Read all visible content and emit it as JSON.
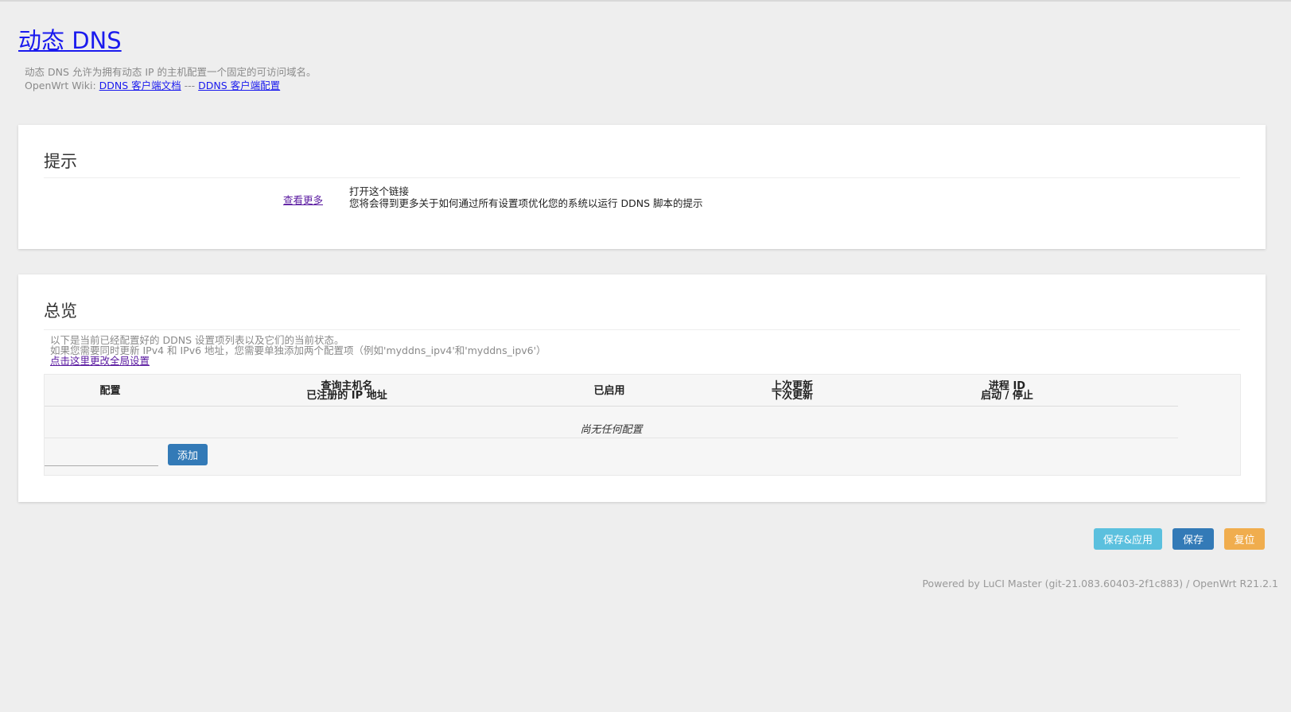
{
  "page": {
    "title": "动态 DNS",
    "intro_line1": "动态 DNS 允许为拥有动态 IP 的主机配置一个固定的可访问域名。",
    "wiki_prefix": "OpenWrt Wiki: ",
    "wiki_link1": "DDNS 客户端文档",
    "wiki_separator": " --- ",
    "wiki_link2": "DDNS 客户端配置"
  },
  "hints": {
    "title": "提示",
    "link_label": "查看更多",
    "line1": "打开这个链接",
    "line2": "您将会得到更多关于如何通过所有设置项优化您的系统以运行 DDNS 脚本的提示"
  },
  "overview": {
    "title": "总览",
    "desc_line1": "以下是当前已经配置好的 DDNS 设置项列表以及它们的当前状态。",
    "desc_line2": "如果您需要同时更新 IPv4 和 IPv6 地址，您需要单独添加两个配置项（例如'myddns_ipv4'和'myddns_ipv6'）",
    "global_link": "点击这里更改全局设置",
    "columns": {
      "config": "配置",
      "hostname_a": "查询主机名",
      "hostname_b": "已注册的 IP 地址",
      "enabled": "已启用",
      "update_a": "上次更新",
      "update_b": "下次更新",
      "pid_a": "进程 ID",
      "pid_b": "启动 / 停止"
    },
    "empty_text": "尚无任何配置",
    "add_input_value": "",
    "add_button": "添加"
  },
  "actions": {
    "save_apply": "保存&应用",
    "save": "保存",
    "reset": "复位"
  },
  "footer": {
    "text": "Powered by LuCI Master (git-21.083.60403-2f1c883) / OpenWrt R21.2.1"
  },
  "colors": {
    "background": "#eeeeee",
    "link": "#1a1aee",
    "visited_link": "#5a1aa0",
    "btn_info": "#5bc0de",
    "btn_primary": "#337ab7",
    "btn_warning": "#f0ad4e"
  }
}
